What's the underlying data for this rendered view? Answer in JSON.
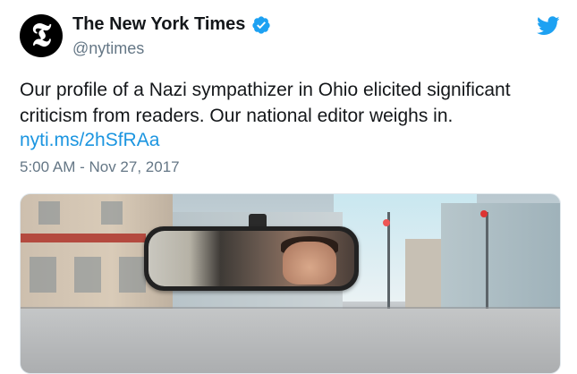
{
  "tweet": {
    "author_name": "The New York Times",
    "author_handle": "@nytimes",
    "avatar_glyph": "𝕿",
    "verified_icon": "verified-badge-icon",
    "platform_icon": "twitter-bird-icon",
    "text": "Our profile of a Nazi sympathizer in Ohio elicited significant criticism from readers. Our national editor weighs in.",
    "link": "nyti.ms/2hSfRAa",
    "timestamp": "5:00 AM - Nov 27, 2017",
    "media_description_icon": "photo-image"
  },
  "colors": {
    "link": "#1b95e0",
    "twitter_blue": "#1da1f2",
    "secondary_text": "#657786",
    "primary_text": "#14171a"
  }
}
